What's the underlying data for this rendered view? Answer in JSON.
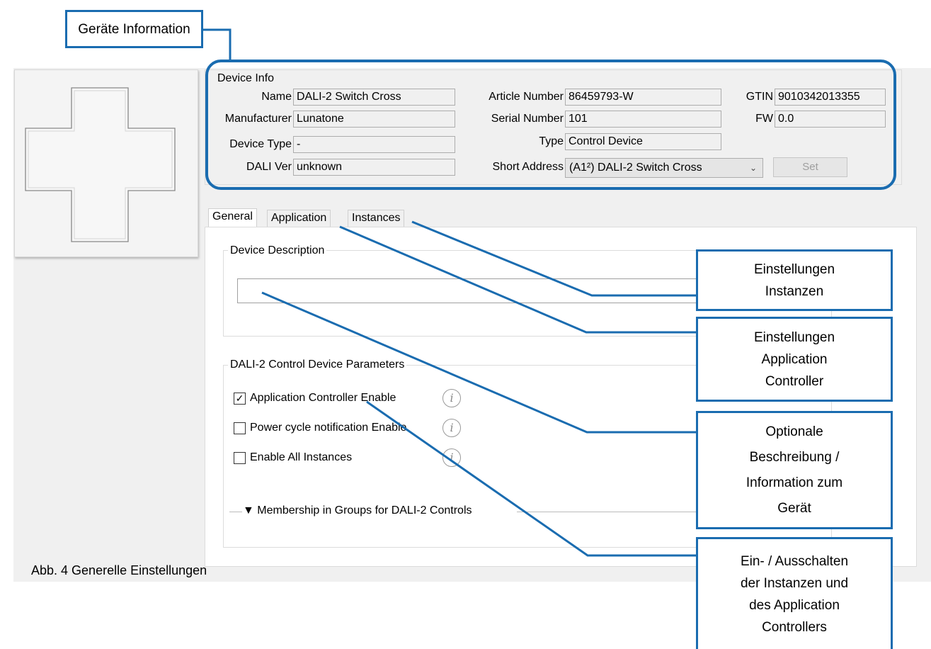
{
  "device_info": {
    "group_label": "Device Info",
    "name_label": "Name",
    "name_value": "DALI-2 Switch Cross",
    "manufacturer_label": "Manufacturer",
    "manufacturer_value": "Lunatone",
    "device_type_label": "Device Type",
    "device_type_value": "-",
    "dali_ver_label": "DALI Ver",
    "dali_ver_value": "unknown",
    "article_number_label": "Article Number",
    "article_number_value": "86459793-W",
    "serial_number_label": "Serial Number",
    "serial_number_value": "101",
    "type_label": "Type",
    "type_value": "Control Device",
    "short_address_label": "Short Address",
    "short_address_value": "(A1²) DALI-2 Switch Cross",
    "gtin_label": "GTIN",
    "gtin_value": "9010342013355",
    "fw_label": "FW",
    "fw_value": "0.0",
    "set_button": "Set"
  },
  "tabs": [
    {
      "label": "General",
      "active": true
    },
    {
      "label": "Application",
      "active": false
    },
    {
      "label": "Instances",
      "active": false
    }
  ],
  "general": {
    "device_description_label": "Device Description",
    "device_description_value": "",
    "params_label": "DALI-2 Control Device Parameters",
    "checkboxes": [
      {
        "label": "Application Controller Enable",
        "checked": true
      },
      {
        "label": "Power cycle notification Enable",
        "checked": false
      },
      {
        "label": "Enable All Instances",
        "checked": false
      }
    ],
    "membership_label": "▼ Membership in Groups for DALI-2 Controls"
  },
  "callouts": {
    "geraete_information": "Geräte Information",
    "einstellungen_instanzen": [
      "Einstellungen",
      "Instanzen"
    ],
    "einstellungen_application": [
      "Einstellungen",
      "Application",
      "Controller"
    ],
    "optionale_beschreibung": [
      "Optionale",
      "Beschreibung /",
      "Information zum",
      "Gerät"
    ],
    "ein_ausschalten": [
      "Ein- / Ausschalten",
      "der Instanzen und",
      "des Application",
      "Controllers"
    ]
  },
  "caption": "Abb. 4 Generelle Einstellungen",
  "colors": {
    "accent": "#1a6cb0",
    "window_bg": "#f0f0f0"
  },
  "icons": {
    "info": "info-icon",
    "device": "cross-switch-icon"
  }
}
